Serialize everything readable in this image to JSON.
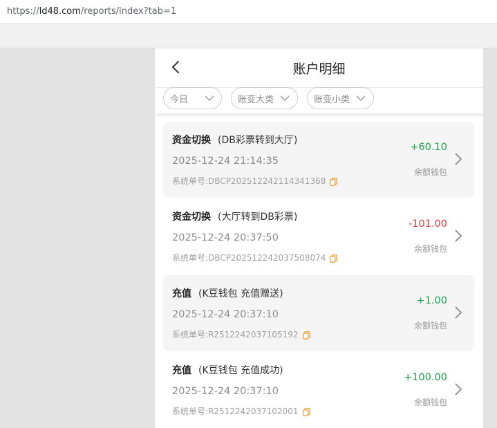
{
  "browser": {
    "url_prefix": "https://",
    "url_host": "ld48.com",
    "url_path": "/reports/index?tab=1"
  },
  "header": {
    "title": "账户明细",
    "back_icon": "chevron-left-icon"
  },
  "filters": [
    {
      "label": "今日"
    },
    {
      "label": "账变大类"
    },
    {
      "label": "账变小类"
    }
  ],
  "order_prefix": "系统单号:",
  "colors": {
    "positive": "#1aa34a",
    "negative": "#e53935",
    "card_bg": "#f5f5f5",
    "copy_icon": "#e8a23a"
  },
  "records": [
    {
      "type": "资金切换",
      "detail": "(DB彩票转到大厅)",
      "time": "2025-12-24 21:14:35",
      "order_no": "DBCP20251224211434​1368",
      "amount": "+60.10",
      "amount_sign": "positive",
      "wallet": "余额钱包",
      "shaded": true
    },
    {
      "type": "资金切换",
      "detail": "(大厅转到DB彩票)",
      "time": "2025-12-24 20:37:50",
      "order_no": "DBCP202512242037508074",
      "amount": "-101.00",
      "amount_sign": "negative",
      "wallet": "余额钱包",
      "shaded": false
    },
    {
      "type": "充值",
      "detail": "(K豆钱包 充值赠送)",
      "time": "2025-12-24 20:37:10",
      "order_no": "R2512242037105192",
      "amount": "+1.00",
      "amount_sign": "positive",
      "wallet": "余额钱包",
      "shaded": true
    },
    {
      "type": "充值",
      "detail": "(K豆钱包 充值成功)",
      "time": "2025-12-24 20:37:10",
      "order_no": "R2512242037102001",
      "amount": "+100.00",
      "amount_sign": "positive",
      "wallet": "余额钱包",
      "shaded": false
    }
  ]
}
